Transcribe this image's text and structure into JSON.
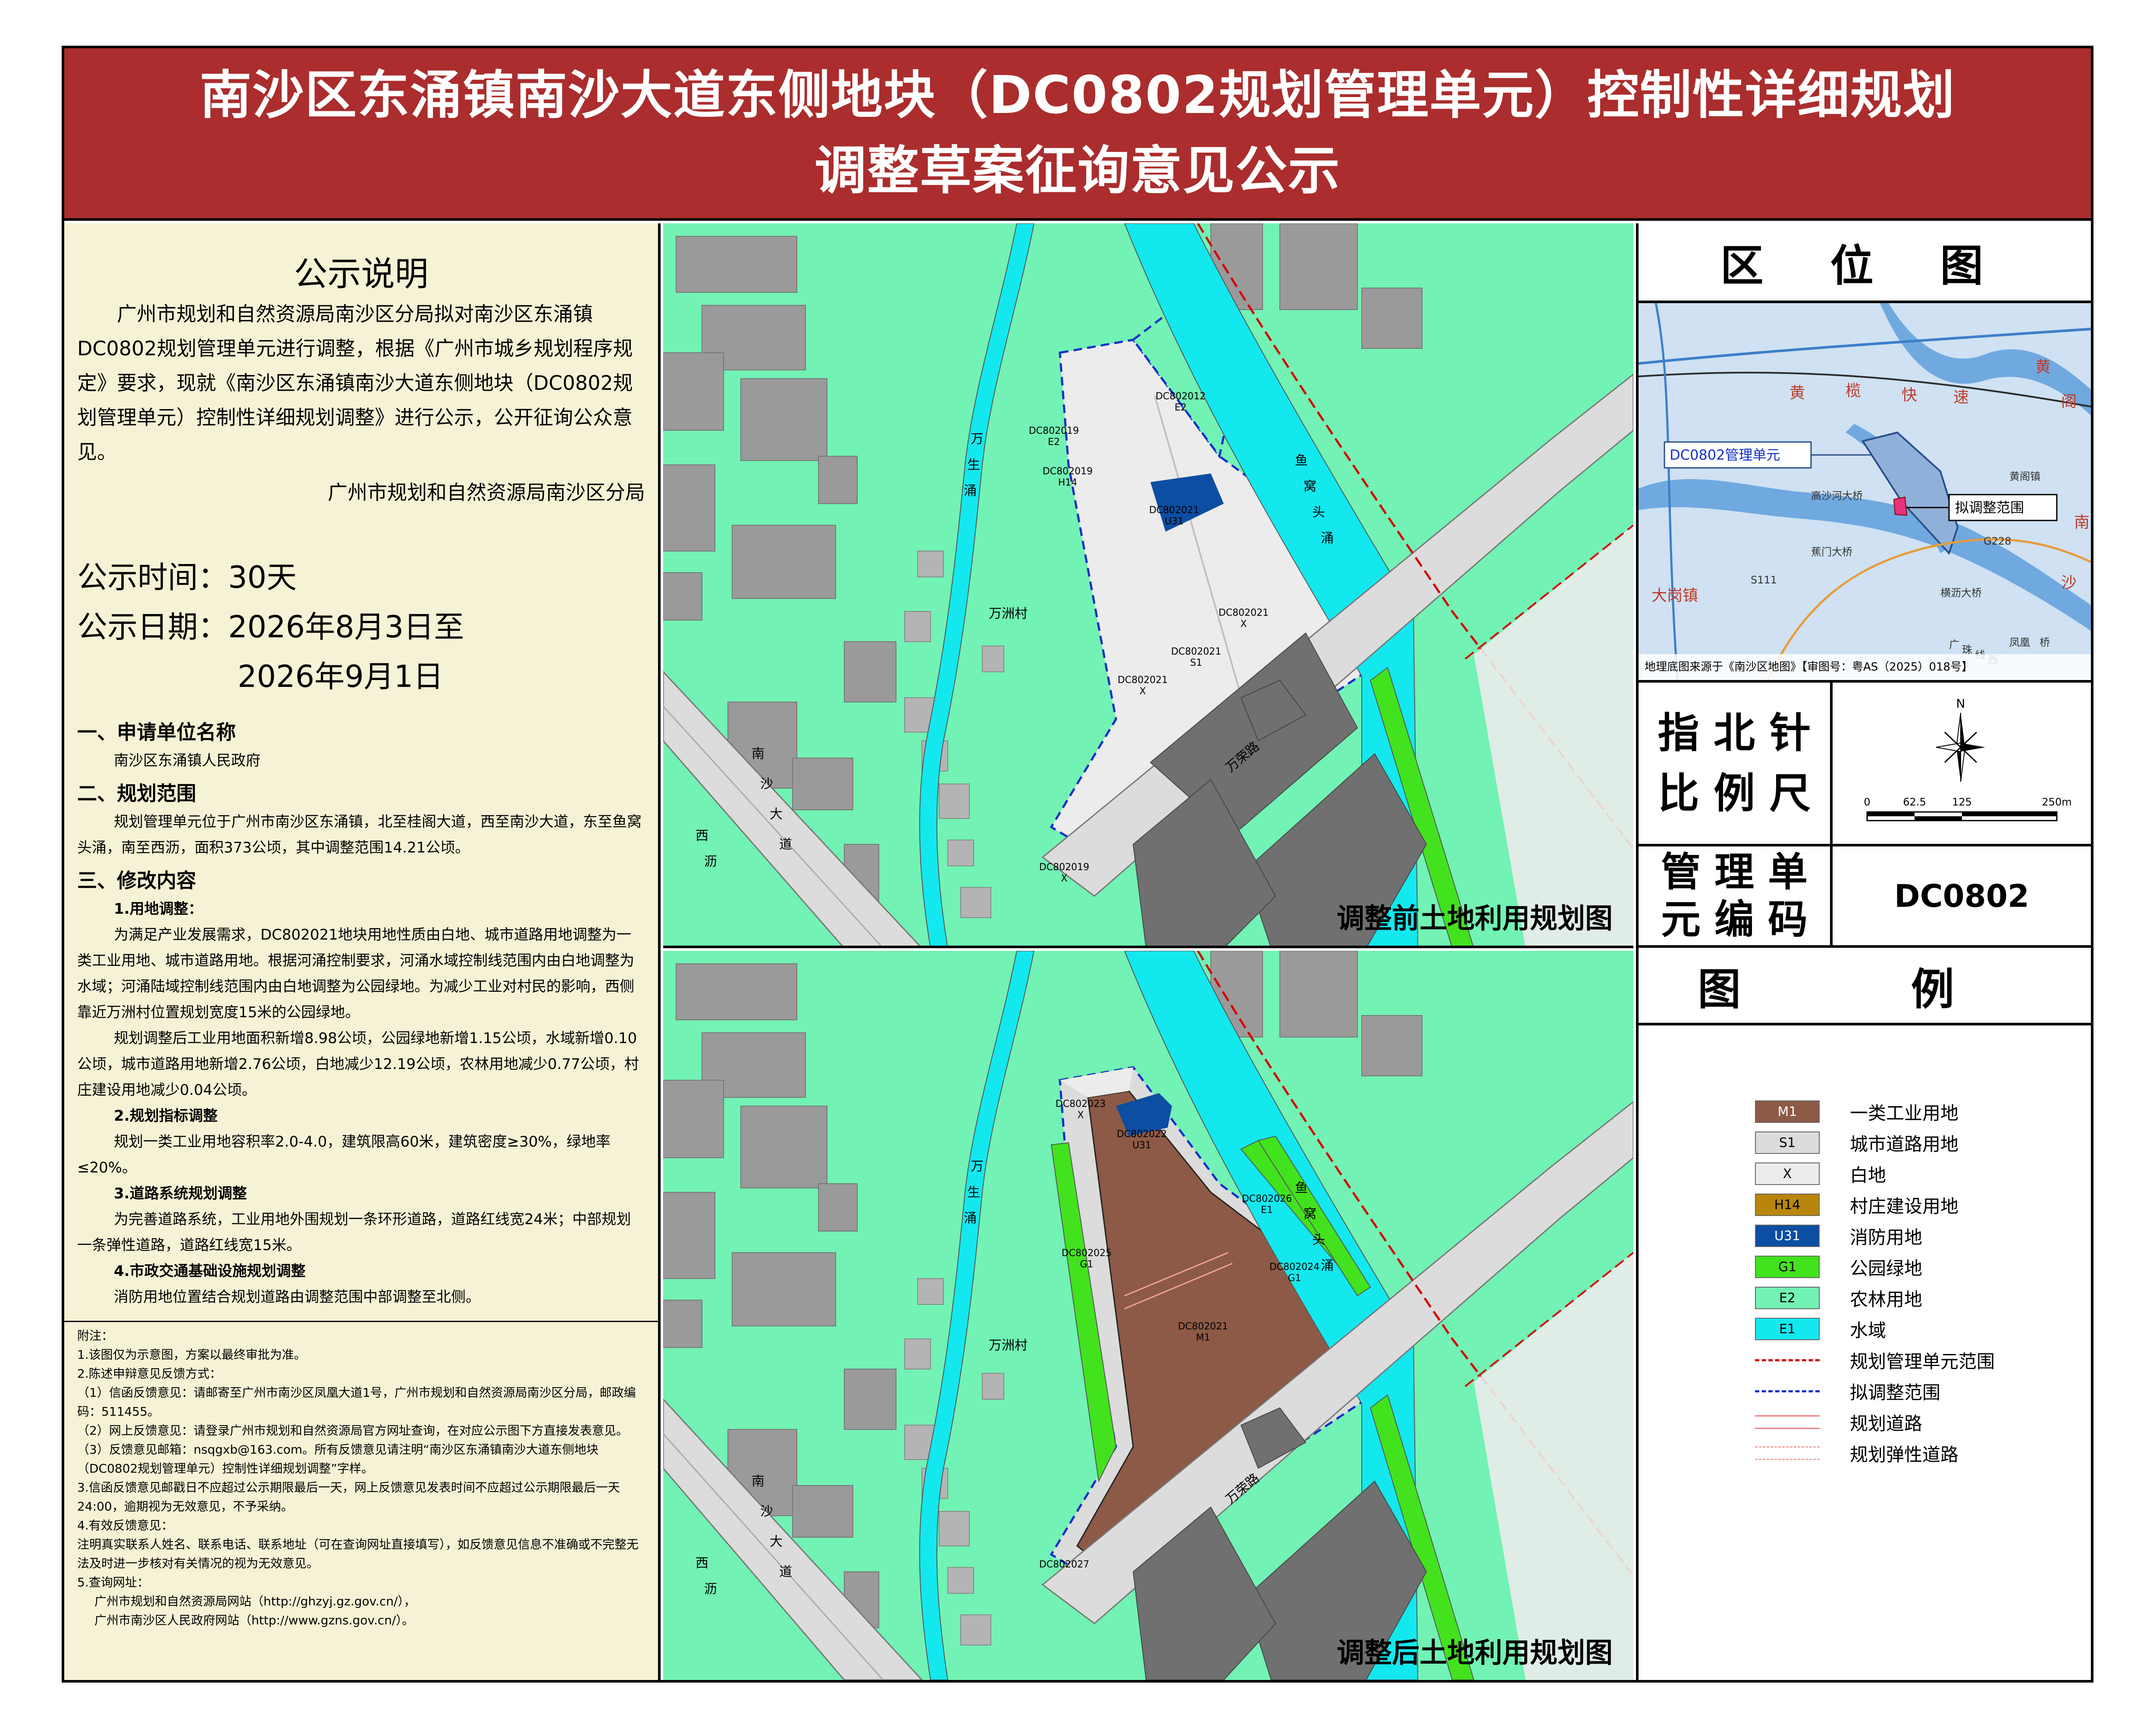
{
  "header": {
    "line1": "南沙区东涌镇南沙大道东侧地块（DC0802规划管理单元）控制性详细规划",
    "line2": "调整草案征询意见公示"
  },
  "notice": {
    "title": "公示说明",
    "intro": "广州市规划和自然资源局南沙区分局拟对南沙区东涌镇DC0802规划管理单元进行调整，根据《广州市城乡规划程序规定》要求，现就《南沙区东涌镇南沙大道东侧地块（DC0802规划管理单元）控制性详细规划调整》进行公示，公开征询公众意见。",
    "signature": "广州市规划和自然资源局南沙区分局",
    "period": "公示时间：30天",
    "date1": "公示日期：2026年8月3日至",
    "date2": "2026年9月1日",
    "s1": "一、申请单位名称",
    "s1_text": "南沙区东涌镇人民政府",
    "s2": "二、规划范围",
    "s2_text": "规划管理单元位于广州市南沙区东涌镇，北至桂阁大道，西至南沙大道，东至鱼窝头涌，南至西沥，面积373公顷，其中调整范围14.21公顷。",
    "s3": "三、修改内容",
    "sub1": "1.用地调整：",
    "p1": "为满足产业发展需求，DC802021地块用地性质由白地、城市道路用地调整为一类工业用地、城市道路用地。根据河涌控制要求，河涌水域控制线范围内由白地调整为水域；河涌陆域控制线范围内由白地调整为公园绿地。为减少工业对村民的影响，西侧靠近万洲村位置规划宽度15米的公园绿地。",
    "p2": "规划调整后工业用地面积新增8.98公顷，公园绿地新增1.15公顷，水域新增0.10公顷，城市道路用地新增2.76公顷，白地减少12.19公顷，农林用地减少0.77公顷，村庄建设用地减少0.04公顷。",
    "sub2": "2.规划指标调整",
    "p3": "规划一类工业用地容积率2.0-4.0，建筑限高60米，建筑密度≥30%，绿地率≤20%。",
    "sub3": "3.道路系统规划调整",
    "p4": "为完善道路系统，工业用地外围规划一条环形道路，道路红线宽24米；中部规划一条弹性道路，道路红线宽15米。",
    "sub4": "4.市政交通基础设施规划调整",
    "p5": "消防用地位置结合规划道路由调整范围中部调整至北侧。",
    "notes": [
      "附注：",
      "1.该图仅为示意图，方案以最终审批为准。",
      "2.陈述申辩意见反馈方式：",
      "（1）信函反馈意见：请邮寄至广州市南沙区凤凰大道1号，广州市规划和自然资源局南沙区分局，邮政编码：511455。",
      "（2）网上反馈意见：请登录广州市规划和自然资源局官方网址查询，在对应公示图下方直接发表意见。",
      "（3）反馈意见邮箱：nsqgxb@163.com。所有反馈意见请注明“南沙区东涌镇南沙大道东侧地块（DC0802规划管理单元）控制性详细规划调整”字样。",
      "3.信函反馈意见邮戳日不应超过公示期限最后一天，网上反馈意见发表时间不应超过公示期限最后一天24:00，逾期视为无效意见，不予采纳。",
      "4.有效反馈意见：",
      "注明真实联系人姓名、联系电话、联系地址（可在查询网址直接填写），如反馈意见信息不准确或不完整无法及时进一步核对有关情况的视为无效意见。",
      "5.查询网址：",
      "广州市规划和自然资源局网站（http://ghzyj.gz.gov.cn/），",
      "广州市南沙区人民政府网站（http://www.gzns.gov.cn/）。"
    ]
  },
  "map_before": {
    "title": "调整前土地利用规划图",
    "labels": {
      "dc802019a": "DC802019",
      "e2a": "E2",
      "dc802012": "DC802012",
      "e2b": "E2",
      "dc802019b": "DC802019",
      "h14": "H14",
      "dc802021a": "DC802021",
      "u31": "U31",
      "dc802021b": "DC802021",
      "xb": "X",
      "dc802021c": "DC802021",
      "s1": "S1",
      "dc802021d": "DC802021",
      "xd": "X",
      "dc802019c": "DC802019",
      "xc": "X",
      "village": "万洲村",
      "wansheng": "万",
      "wansheng2": "生",
      "wansheng3": "涌",
      "yuwo1": "鱼",
      "yuwo2": "窝",
      "yuwo3": "头",
      "yuwo4": "涌",
      "road_wanrong": "万荣路",
      "nansha1": "南",
      "nansha2": "沙",
      "nansha3": "大",
      "nansha4": "道",
      "xili1": "西",
      "xili2": "沥"
    }
  },
  "map_after": {
    "title": "调整后土地利用规划图",
    "labels": {
      "dc802023": "DC802023",
      "x23": "X",
      "dc802022": "DC802022",
      "u31": "U31",
      "dc802026": "DC802026",
      "e1": "E1",
      "dc802025": "DC802025",
      "g1a": "G1",
      "dc802024": "DC802024",
      "g1b": "G1",
      "dc802021": "DC802021",
      "m1": "M1",
      "dc802027": "DC802027",
      "village": "万洲村",
      "wansheng": "万",
      "wansheng2": "生",
      "wansheng3": "涌",
      "yuwo1": "鱼",
      "yuwo2": "窝",
      "yuwo3": "头",
      "yuwo4": "涌",
      "road_wanrong": "万荣路",
      "nansha1": "南",
      "nansha2": "沙",
      "nansha3": "大",
      "nansha4": "道",
      "xili1": "西",
      "xili2": "沥"
    }
  },
  "location": {
    "title": "区 位 图",
    "unit_label": "DC0802管理单元",
    "adjust_label": "拟调整范围",
    "source": "地理底图来源于《南沙区地图》【审图号：粤AS（2025）018号】",
    "places": {
      "huangge": "黄阁镇",
      "gaosha": "高沙河大桥",
      "jiaomen": "蕉门大桥",
      "hengjiao": "横沥大桥",
      "dagang": "大岗镇",
      "huangge2": "黄",
      "huangge3": "阁",
      "kuaisu": "快",
      "kuaisu2": "速",
      "huang": "黄",
      "lan": "榄",
      "s111": "S111",
      "nansha": "南",
      "nansha2": "沙",
      "g228": "G228",
      "fenghuang": "凤凰",
      "qiao": "桥",
      "guangzhu": "广",
      "zhu": "珠",
      "xi": "线",
      "xi2": "西"
    }
  },
  "north": {
    "label1": "指 北 针",
    "label2": "比 例 尺",
    "n": "N",
    "ticks": [
      "0",
      "62.5",
      "125",
      "250m"
    ]
  },
  "unit": {
    "label1": "管 理 单",
    "label2": "元 编 码",
    "code": "DC0802"
  },
  "legend": {
    "title": "图 例",
    "items": [
      {
        "code": "M1",
        "label": "一类工业用地",
        "color": "#8c5a46"
      },
      {
        "code": "S1",
        "label": "城市道路用地",
        "color": "#dcdcdc"
      },
      {
        "code": "X",
        "label": "白地",
        "color": "#ececec"
      },
      {
        "code": "H14",
        "label": "村庄建设用地",
        "color": "#b8860b"
      },
      {
        "code": "U31",
        "label": "消防用地",
        "color": "#0b4ea2"
      },
      {
        "code": "G1",
        "label": "公园绿地",
        "color": "#43e21e"
      },
      {
        "code": "E2",
        "label": "农林用地",
        "color": "#72f2b4"
      },
      {
        "code": "E1",
        "label": "水域",
        "color": "#13e8ef"
      },
      {
        "code": "",
        "label": "规划管理单元范围",
        "color": "#d40000"
      },
      {
        "code": "",
        "label": "拟调整范围",
        "color": "#1530c8"
      },
      {
        "code": "",
        "label": "规划道路",
        "color": "#f08080"
      },
      {
        "code": "",
        "label": "规划弹性道路",
        "color": "#f4a0a0"
      }
    ]
  }
}
